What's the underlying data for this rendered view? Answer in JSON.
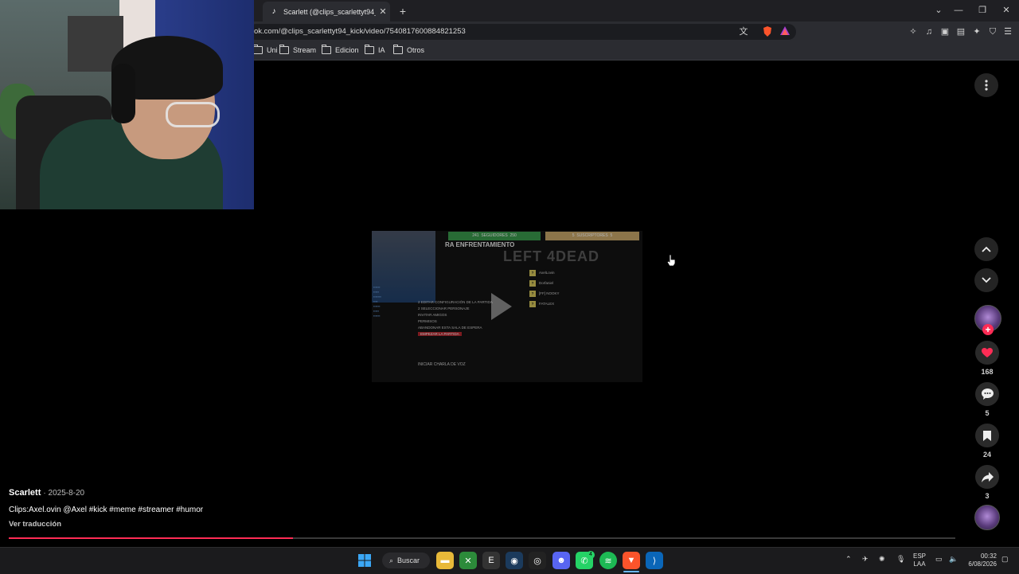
{
  "browser": {
    "tab_title": "Scarlett (@clips_scarlettyt94_kick",
    "url": "ok.com/@clips_scarlettyt94_kick/video/7540817600884821253",
    "bookmarks": [
      "Uni",
      "Stream",
      "Edicion",
      "IA",
      "Otros"
    ]
  },
  "video": {
    "bar_left": "SEGUIDORES",
    "bar_left_count": "241",
    "bar_left_max": "250",
    "bar_right": "SUSCRIPTORES",
    "bar_right_count": "5",
    "bar_right_max": "5",
    "title": "RA ENFRENTAMIENTO",
    "logo": "LEFT 4DEAD",
    "menu": [
      "2 EDITAR CONFIGURACIÓN DE LA PARTIDA",
      "2 SELECCIONAR PERSONAJE",
      "INVITAR AMIGOS",
      "PERMISOS",
      "ABANDONAR ESTA SALA DE ESPERA",
      "EMPEZAR LA PARTIDA"
    ],
    "players": [
      "AxelLovin",
      "Dorfaniel",
      "[FF] NOOKY",
      "FATALEX"
    ],
    "voice": "INICIAR CHARLA DE VOZ"
  },
  "actions": {
    "likes": "168",
    "comments": "5",
    "saves": "24",
    "shares": "3",
    "follow": "+"
  },
  "post": {
    "author": "Scarlett",
    "date": "· 2025-8-20",
    "caption": "Clips:Axel.ovin  @Axel #kick #meme #streamer #humor",
    "translate": "Ver traducción",
    "progress": 0.3
  },
  "taskbar": {
    "search": "Buscar",
    "lang1": "ESP",
    "lang2": "LAA",
    "time": "00:32",
    "date": "6/08/2026",
    "whatsapp_badge": "4"
  },
  "colors": {
    "accent": "#fe2c55",
    "background": "#000000"
  }
}
